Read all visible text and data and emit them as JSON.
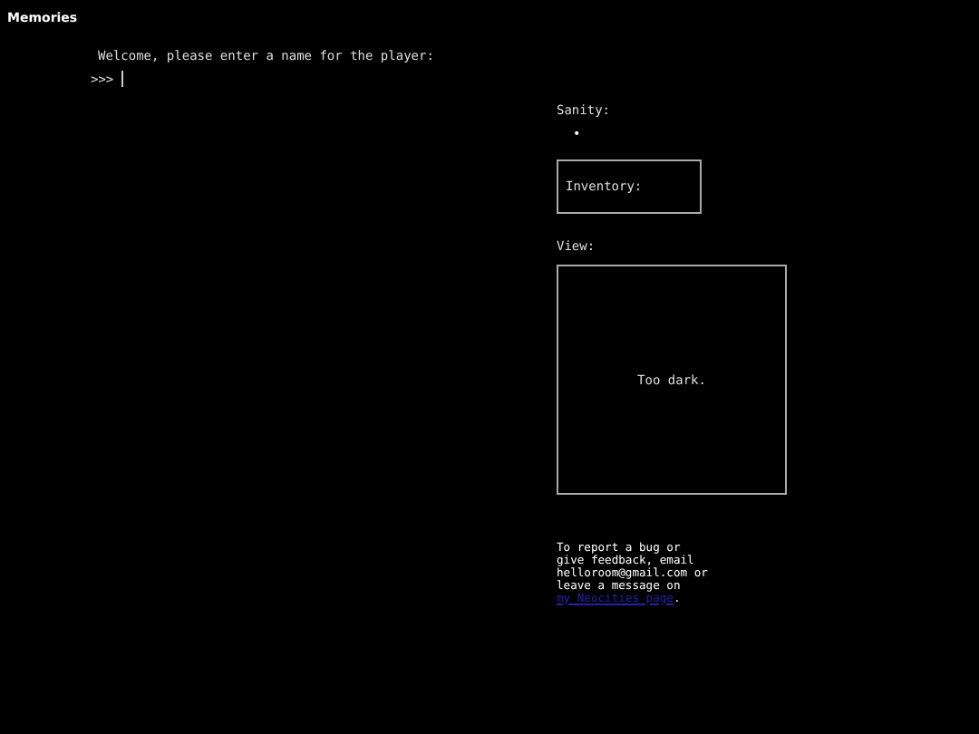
{
  "window": {
    "title": "Memories"
  },
  "console": {
    "message": "Welcome, please enter a name for the player:",
    "prompt": ">>>"
  },
  "sanity": {
    "label": "Sanity:",
    "value": "•"
  },
  "inventory": {
    "label": "Inventory:"
  },
  "view": {
    "label": "View:",
    "text": "Too dark."
  },
  "footer": {
    "text": "To report a bug or give feedback, email helloroom@gmail.com or leave a message on",
    "link": "my Neocities page",
    "end": "."
  }
}
